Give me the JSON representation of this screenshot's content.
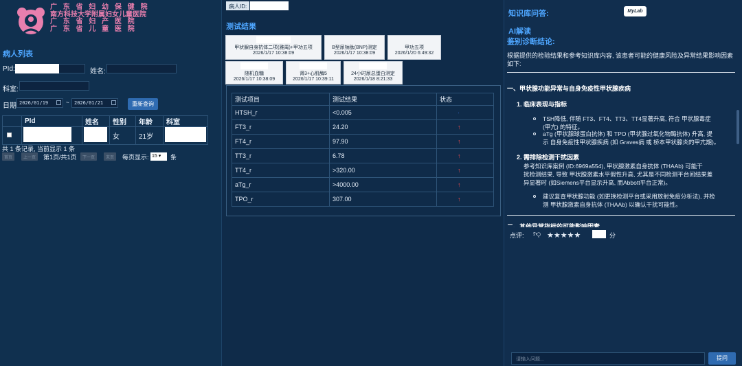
{
  "hospital_names": [
    "广 东 省 妇 幼 保 健 院",
    "南方科技大学附属妇女儿童医院",
    "广 东 省 妇 产 医 院",
    "广 东 省 儿 童 医 院"
  ],
  "left": {
    "patient_list_title": "病人列表",
    "pid_label": "PId:",
    "name_label": "姓名:",
    "dept_label": "科室:",
    "date_label": "日期:",
    "date_from": "2026/01/19",
    "date_tilde": "~",
    "date_to": "2026/01/21",
    "requery_btn": "重新查询",
    "table": {
      "headers": [
        "",
        "PId",
        "姓名",
        "性别",
        "年龄",
        "科室"
      ],
      "rows": [
        {
          "sex": "女",
          "age": "21岁"
        }
      ]
    },
    "record_summary": "共 1 条记录, 当前显示 1 条",
    "pager": {
      "first": "首页",
      "prev": "上一页",
      "page_info": "第1页/共1页",
      "next": "下一页",
      "last": "末页",
      "per_page_label": "每页显示:",
      "per_page_value": "15",
      "unit": "条"
    }
  },
  "middle": {
    "pid_label": "病人ID:",
    "results_title": "测试结果",
    "tests": [
      {
        "name": "甲状腺自身抗体二项(雅禺)+甲功五项",
        "date": "2026/1/17 10:38:09"
      },
      {
        "name": "B型尿钠肽(BNP)测定",
        "date": "2026/1/17 10:38:09"
      },
      {
        "name": "甲功五项",
        "date": "2026/1/20 6:49:32"
      },
      {
        "name": "随机血糖",
        "date": "2026/1/17 10:38:09"
      },
      {
        "name": "肾3+心肌酶5",
        "date": "2026/1/17 10:39:11"
      },
      {
        "name": "24小时尿总蛋白测定",
        "date": "2026/1/18 8:21:33"
      }
    ],
    "result_table": {
      "headers": [
        "测试项目",
        "测试结果",
        "状态"
      ],
      "rows": [
        {
          "item": "HTSH_r",
          "value": "<0.005",
          "status": "·"
        },
        {
          "item": "FT3_r",
          "value": "24.20",
          "status": "↑"
        },
        {
          "item": "FT4_r",
          "value": "97.90",
          "status": "↑"
        },
        {
          "item": "TT3_r",
          "value": "6.78",
          "status": "↑"
        },
        {
          "item": "TT4_r",
          "value": ">320.00",
          "status": "↑"
        },
        {
          "item": "aTg_r",
          "value": ">4000.00",
          "status": "↑"
        },
        {
          "item": "TPO_r",
          "value": "307.00",
          "status": "↑"
        }
      ]
    }
  },
  "right": {
    "kb_title": "知识库问答:",
    "mylab": "MyLab",
    "ai_title": "AI解读",
    "diag_title": "鉴别诊断结论:",
    "intro": "根据提供的检验结果和参考知识库内容, 该患者可能的健康风险及异常结果影响因素如下:",
    "sec1": "一、甲状腺功能异常与自身免疫性甲状腺疾病",
    "sub1": "1. 临床表现与指标",
    "b1_line1": "TSH降低, 伴随 FT3、FT4、TT3、TT4显著升高, 符合 甲状腺毒症",
    "b1_line2": "(甲亢) 的特征。",
    "b2_line1": "aTg (甲状腺球蛋白抗体) 和 TPO (甲状腺过氧化物酶抗体) 升高, 提",
    "b2_line2": "示 自身免疫性甲状腺疾病 (如 Graves病 或 桥本甲状腺炎的甲亢期)。",
    "sub2": "2. 需排除检测干扰因素",
    "p2_line1": "参考知识库案例 (ID:6969a554), 甲状腺激素自身抗体 (THAAb) 可能干",
    "p2_line2": "扰检测结果, 导致 甲状腺激素水平假性升高, 尤其是不同检测平台间结果差",
    "p2_line3": "异显著时 (如Siemens平台显示升高, 而Abbott平台正常)。",
    "b3_line1": "建议复查甲状腺功能 (如更换检测平台或采用放射免疫分析法), 并检",
    "b3_line2": "测 甲状腺激素自身抗体 (THAAb) 以确认干扰可能性。",
    "sec2_partial": "二、其他异常指标的可能影响因素",
    "rating_label": "点评:",
    "rating_stars": 5,
    "score_unit": "分",
    "ask_placeholder": "请输入问题...",
    "ask_btn": "提问"
  }
}
